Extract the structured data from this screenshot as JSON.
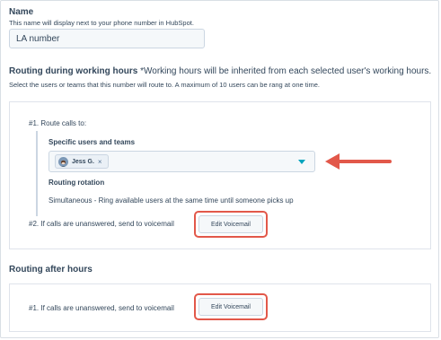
{
  "name_field": {
    "label": "Name",
    "help": "This name will display next to your phone number in HubSpot.",
    "value": "LA number"
  },
  "working_hours": {
    "title": "Routing during working hours",
    "note": "*Working hours will be inherited from each selected user's working hours.",
    "help": "Select the users or teams that this number will route to. A maximum of 10 users can be rang at one time.",
    "step1_label": "#1. Route calls to:",
    "users_label": "Specific users and teams",
    "selected_chip": "Jess G.",
    "chip_remove": "×",
    "rotation_label": "Routing rotation",
    "rotation_value": "Simultaneous - Ring available users at the same time until someone picks up",
    "step2_label": "#2. If calls are unanswered, send to voicemail",
    "voicemail_button": "Edit Voicemail"
  },
  "after_hours": {
    "title": "Routing after hours",
    "step1_label": "#1. If calls are unanswered, send to voicemail",
    "voicemail_button": "Edit Voicemail"
  },
  "colors": {
    "annotation": "#e2584a",
    "accent": "#00a4bd",
    "text": "#33475b"
  }
}
